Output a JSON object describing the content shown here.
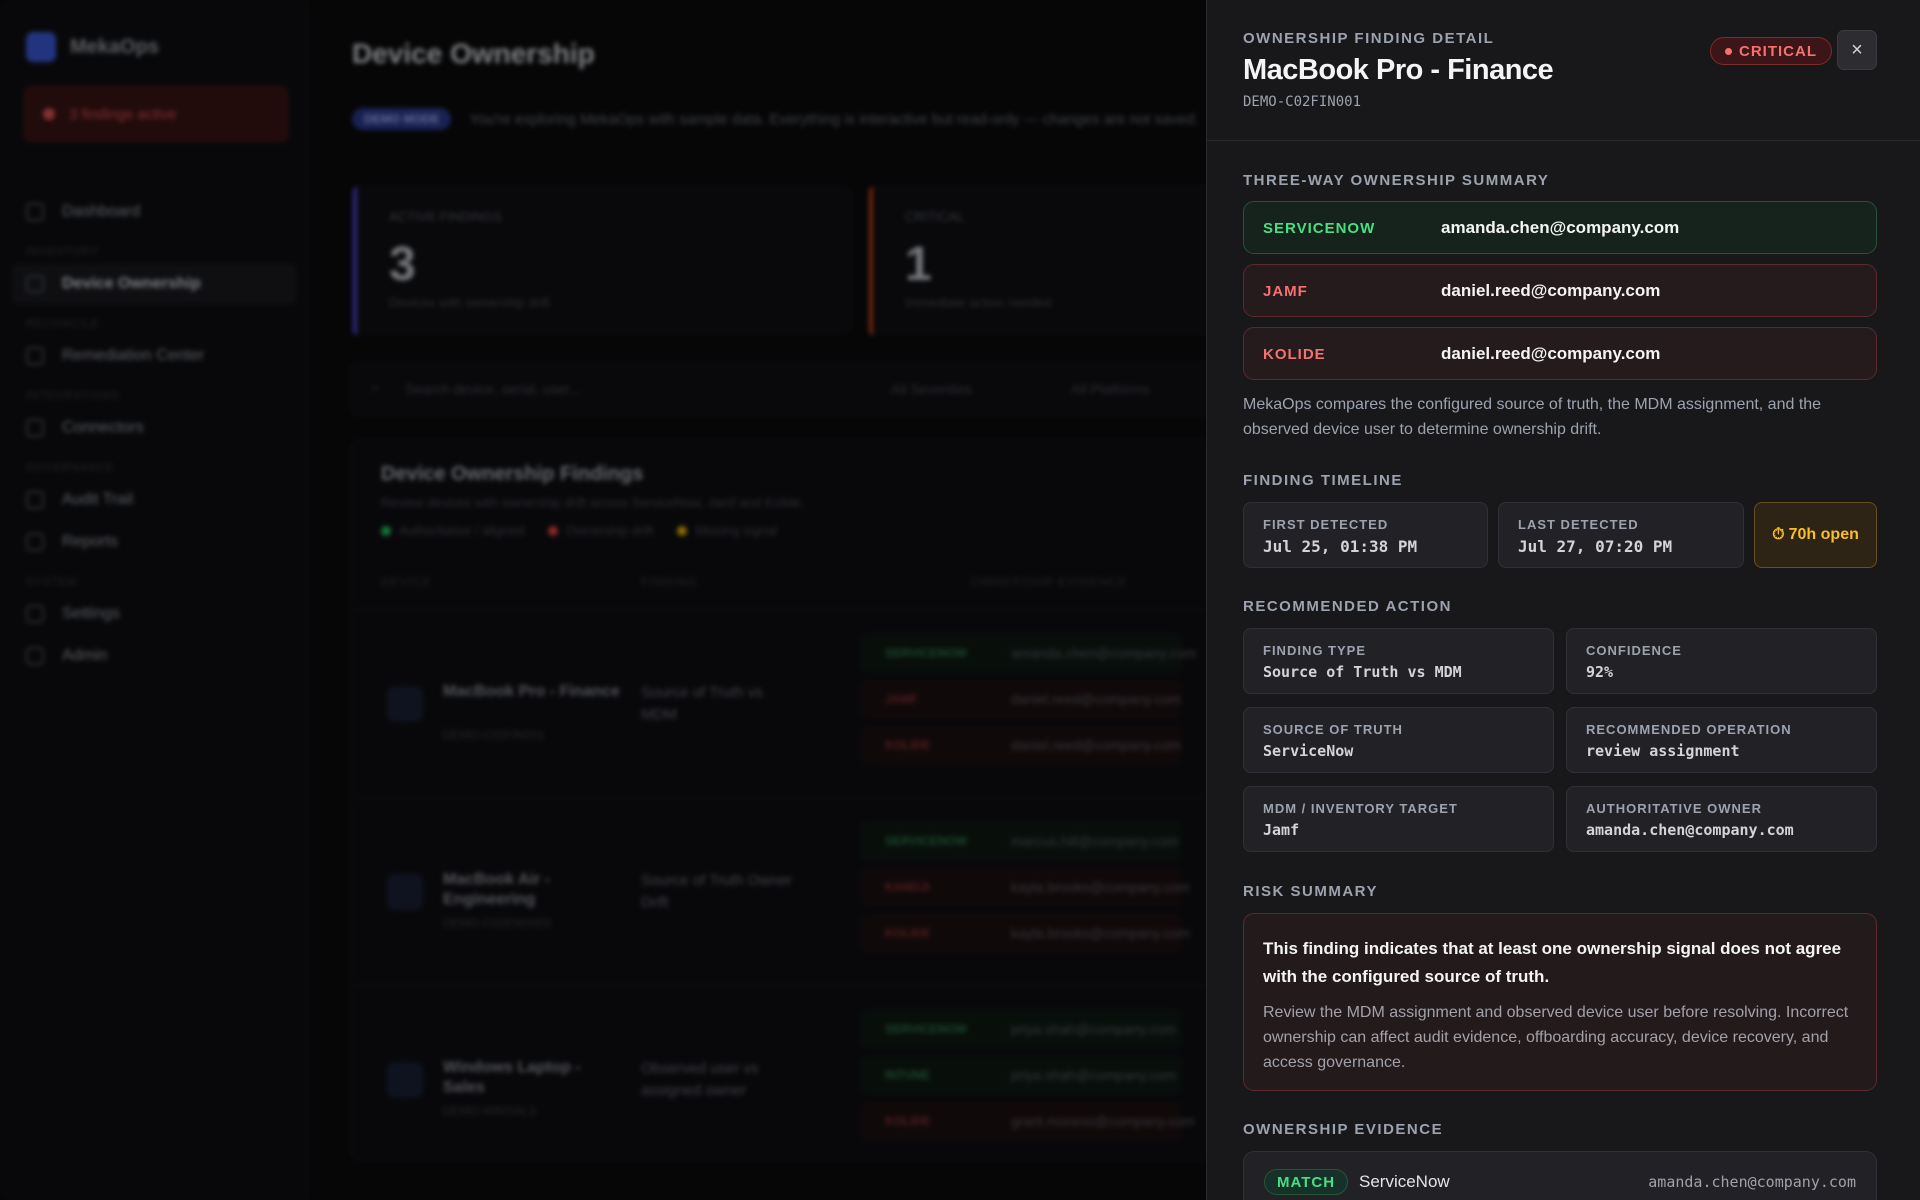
{
  "background": {
    "app_name": "MekaOps",
    "findings_badge": "3 findings active",
    "nav": [
      {
        "section": "",
        "label": "Dashboard"
      },
      {
        "section": "INVENTORY",
        "label": "Device Ownership",
        "active": true
      },
      {
        "section": "RECONCILE",
        "label": "Remediation Center"
      },
      {
        "section": "INTEGRATIONS",
        "label": "Connectors"
      },
      {
        "section": "GOVERNANCE",
        "label": "Audit Trail"
      },
      {
        "section": "",
        "label": "Reports"
      },
      {
        "section": "SYSTEM",
        "label": "Settings"
      },
      {
        "section": "",
        "label": "Admin"
      }
    ],
    "page_title": "Device Ownership",
    "demo_pill": "DEMO MODE",
    "demo_text": "You're exploring MekaOps with sample data. Everything is interactive but read-only — changes are not saved.",
    "stats": [
      {
        "label": "ACTIVE FINDINGS",
        "value": "3",
        "sub": "Devices with ownership drift",
        "color": "#4f46e5"
      },
      {
        "label": "CRITICAL",
        "value": "1",
        "sub": "Immediate action needed",
        "color": "#c2410c"
      }
    ],
    "filters": {
      "search_placeholder": "Search device, serial, user...",
      "dd1": "All Severities",
      "dd2": "All Platforms"
    },
    "table": {
      "title": "Device Ownership Findings",
      "subtitle": "Review devices with ownership drift across ServiceNow, Jamf and Kolide.",
      "legend": [
        {
          "label": "Authoritative / aligned",
          "color": "#22c55e"
        },
        {
          "label": "Ownership drift",
          "color": "#ef4444"
        },
        {
          "label": "Missing signal",
          "color": "#eab308"
        }
      ],
      "headers": [
        "DEVICE",
        "FINDING",
        "OWNERSHIP EVIDENCE"
      ],
      "rows": [
        {
          "name": "MacBook Pro - Finance",
          "id": "DEMO-C02FIN001",
          "type": "Source of Truth vs MDM",
          "sources": [
            {
              "n": "SERVICENOW",
              "e": "amanda.chen@company.com",
              "ok": true
            },
            {
              "n": "JAMF",
              "e": "daniel.reed@company.com",
              "ok": false
            },
            {
              "n": "KOLIDE",
              "e": "daniel.reed@company.com",
              "ok": false
            }
          ]
        },
        {
          "name": "MacBook Air - Engineering",
          "id": "DEMO-C02ENG002",
          "type": "Source of Truth Owner Drift",
          "sources": [
            {
              "n": "SERVICENOW",
              "e": "marcus.hill@company.com",
              "ok": true
            },
            {
              "n": "KANDJI",
              "e": "kayla.brooks@company.com",
              "ok": false
            },
            {
              "n": "KOLIDE",
              "e": "kayla.brooks@company.com",
              "ok": false
            }
          ]
        },
        {
          "name": "Windows Laptop - Sales",
          "id": "DEMO-WINSAL3",
          "type": "Observed user vs assigned owner",
          "sources": [
            {
              "n": "SERVICENOW",
              "e": "priya.shah@company.com",
              "ok": true
            },
            {
              "n": "INTUNE",
              "e": "priya.shah@company.com",
              "ok": true
            },
            {
              "n": "KOLIDE",
              "e": "grant.moreno@company.com",
              "ok": false
            }
          ]
        }
      ]
    }
  },
  "panel": {
    "eyebrow": "OWNERSHIP FINDING DETAIL",
    "title": "MacBook Pro - Finance",
    "serial": "DEMO-C02FIN001",
    "severity": "CRITICAL",
    "close_glyph": "×",
    "summary_heading": "THREE-WAY OWNERSHIP SUMMARY",
    "summary": [
      {
        "source": "SERVICENOW",
        "email": "amanda.chen@company.com",
        "status": "match"
      },
      {
        "source": "JAMF",
        "email": "daniel.reed@company.com",
        "status": "drift"
      },
      {
        "source": "KOLIDE",
        "email": "daniel.reed@company.com",
        "status": "drift"
      }
    ],
    "summary_note": "MekaOps compares the configured source of truth, the MDM assignment, and the observed device user to determine ownership drift.",
    "timeline_heading": "FINDING TIMELINE",
    "first_detected_label": "FIRST DETECTED",
    "first_detected": "Jul 25, 01:38 PM",
    "last_detected_label": "LAST DETECTED",
    "last_detected": "Jul 27, 07:20 PM",
    "open_duration": "70h open",
    "recommend_heading": "RECOMMENDED ACTION",
    "recommend": [
      {
        "label": "FINDING TYPE",
        "value": "Source of Truth vs MDM"
      },
      {
        "label": "CONFIDENCE",
        "value": "92%"
      },
      {
        "label": "SOURCE OF TRUTH",
        "value": "ServiceNow"
      },
      {
        "label": "RECOMMENDED OPERATION",
        "value": "review assignment"
      },
      {
        "label": "MDM / INVENTORY TARGET",
        "value": "Jamf"
      },
      {
        "label": "AUTHORITATIVE OWNER",
        "value": "amanda.chen@company.com"
      }
    ],
    "risk_heading": "RISK SUMMARY",
    "risk_headline": "This finding indicates that at least one ownership signal does not agree with the configured source of truth.",
    "risk_body": "Review the MDM assignment and observed device user before resolving. Incorrect ownership can affect audit evidence, offboarding accuracy, device recovery, and access governance.",
    "evidence_heading": "OWNERSHIP EVIDENCE",
    "evidence": [
      {
        "badge": "MATCH",
        "source": "ServiceNow",
        "email": "amanda.chen@company.com"
      }
    ],
    "colors": {
      "match": "#4ade80",
      "drift": "#f87171",
      "warning": "#fbbf24"
    }
  }
}
